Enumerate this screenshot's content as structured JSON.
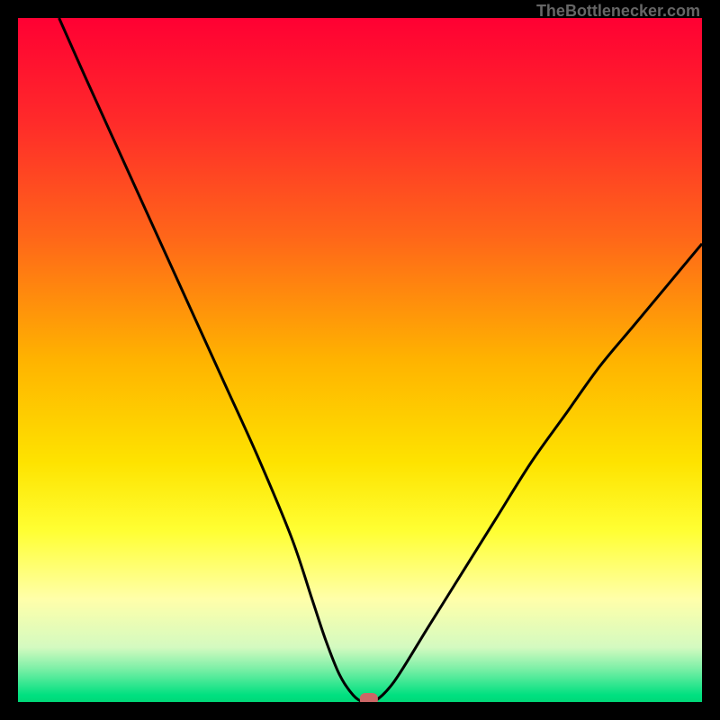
{
  "attribution": "TheBottlenecker.com",
  "chart_data": {
    "type": "line",
    "title": "",
    "xlabel": "",
    "ylabel": "",
    "xlim": [
      0,
      100
    ],
    "ylim": [
      0,
      100
    ],
    "background_gradient": {
      "stops": [
        {
          "pos": 0,
          "color": "#FF0033"
        },
        {
          "pos": 15,
          "color": "#FF2A2A"
        },
        {
          "pos": 32,
          "color": "#FF6619"
        },
        {
          "pos": 50,
          "color": "#FFB300"
        },
        {
          "pos": 65,
          "color": "#FEE300"
        },
        {
          "pos": 75,
          "color": "#FFFF33"
        },
        {
          "pos": 85,
          "color": "#FFFFAA"
        },
        {
          "pos": 92,
          "color": "#D4FAC0"
        },
        {
          "pos": 95,
          "color": "#80F0A8"
        },
        {
          "pos": 99,
          "color": "#00E080"
        },
        {
          "pos": 100,
          "color": "#00D878"
        }
      ]
    },
    "series": [
      {
        "name": "bottleneck-curve",
        "x": [
          6,
          10,
          15,
          20,
          25,
          30,
          35,
          40,
          43,
          45,
          47,
          49,
          50.5,
          52,
          55,
          60,
          65,
          70,
          75,
          80,
          85,
          90,
          95,
          100
        ],
        "y": [
          100,
          91,
          80,
          69,
          58,
          47,
          36,
          24,
          15,
          9,
          4,
          1,
          0,
          0,
          3,
          11,
          19,
          27,
          35,
          42,
          49,
          55,
          61,
          67
        ]
      }
    ],
    "marker": {
      "x": 51.3,
      "y": 0,
      "color": "#CC6666",
      "shape": "rounded-rect"
    }
  }
}
